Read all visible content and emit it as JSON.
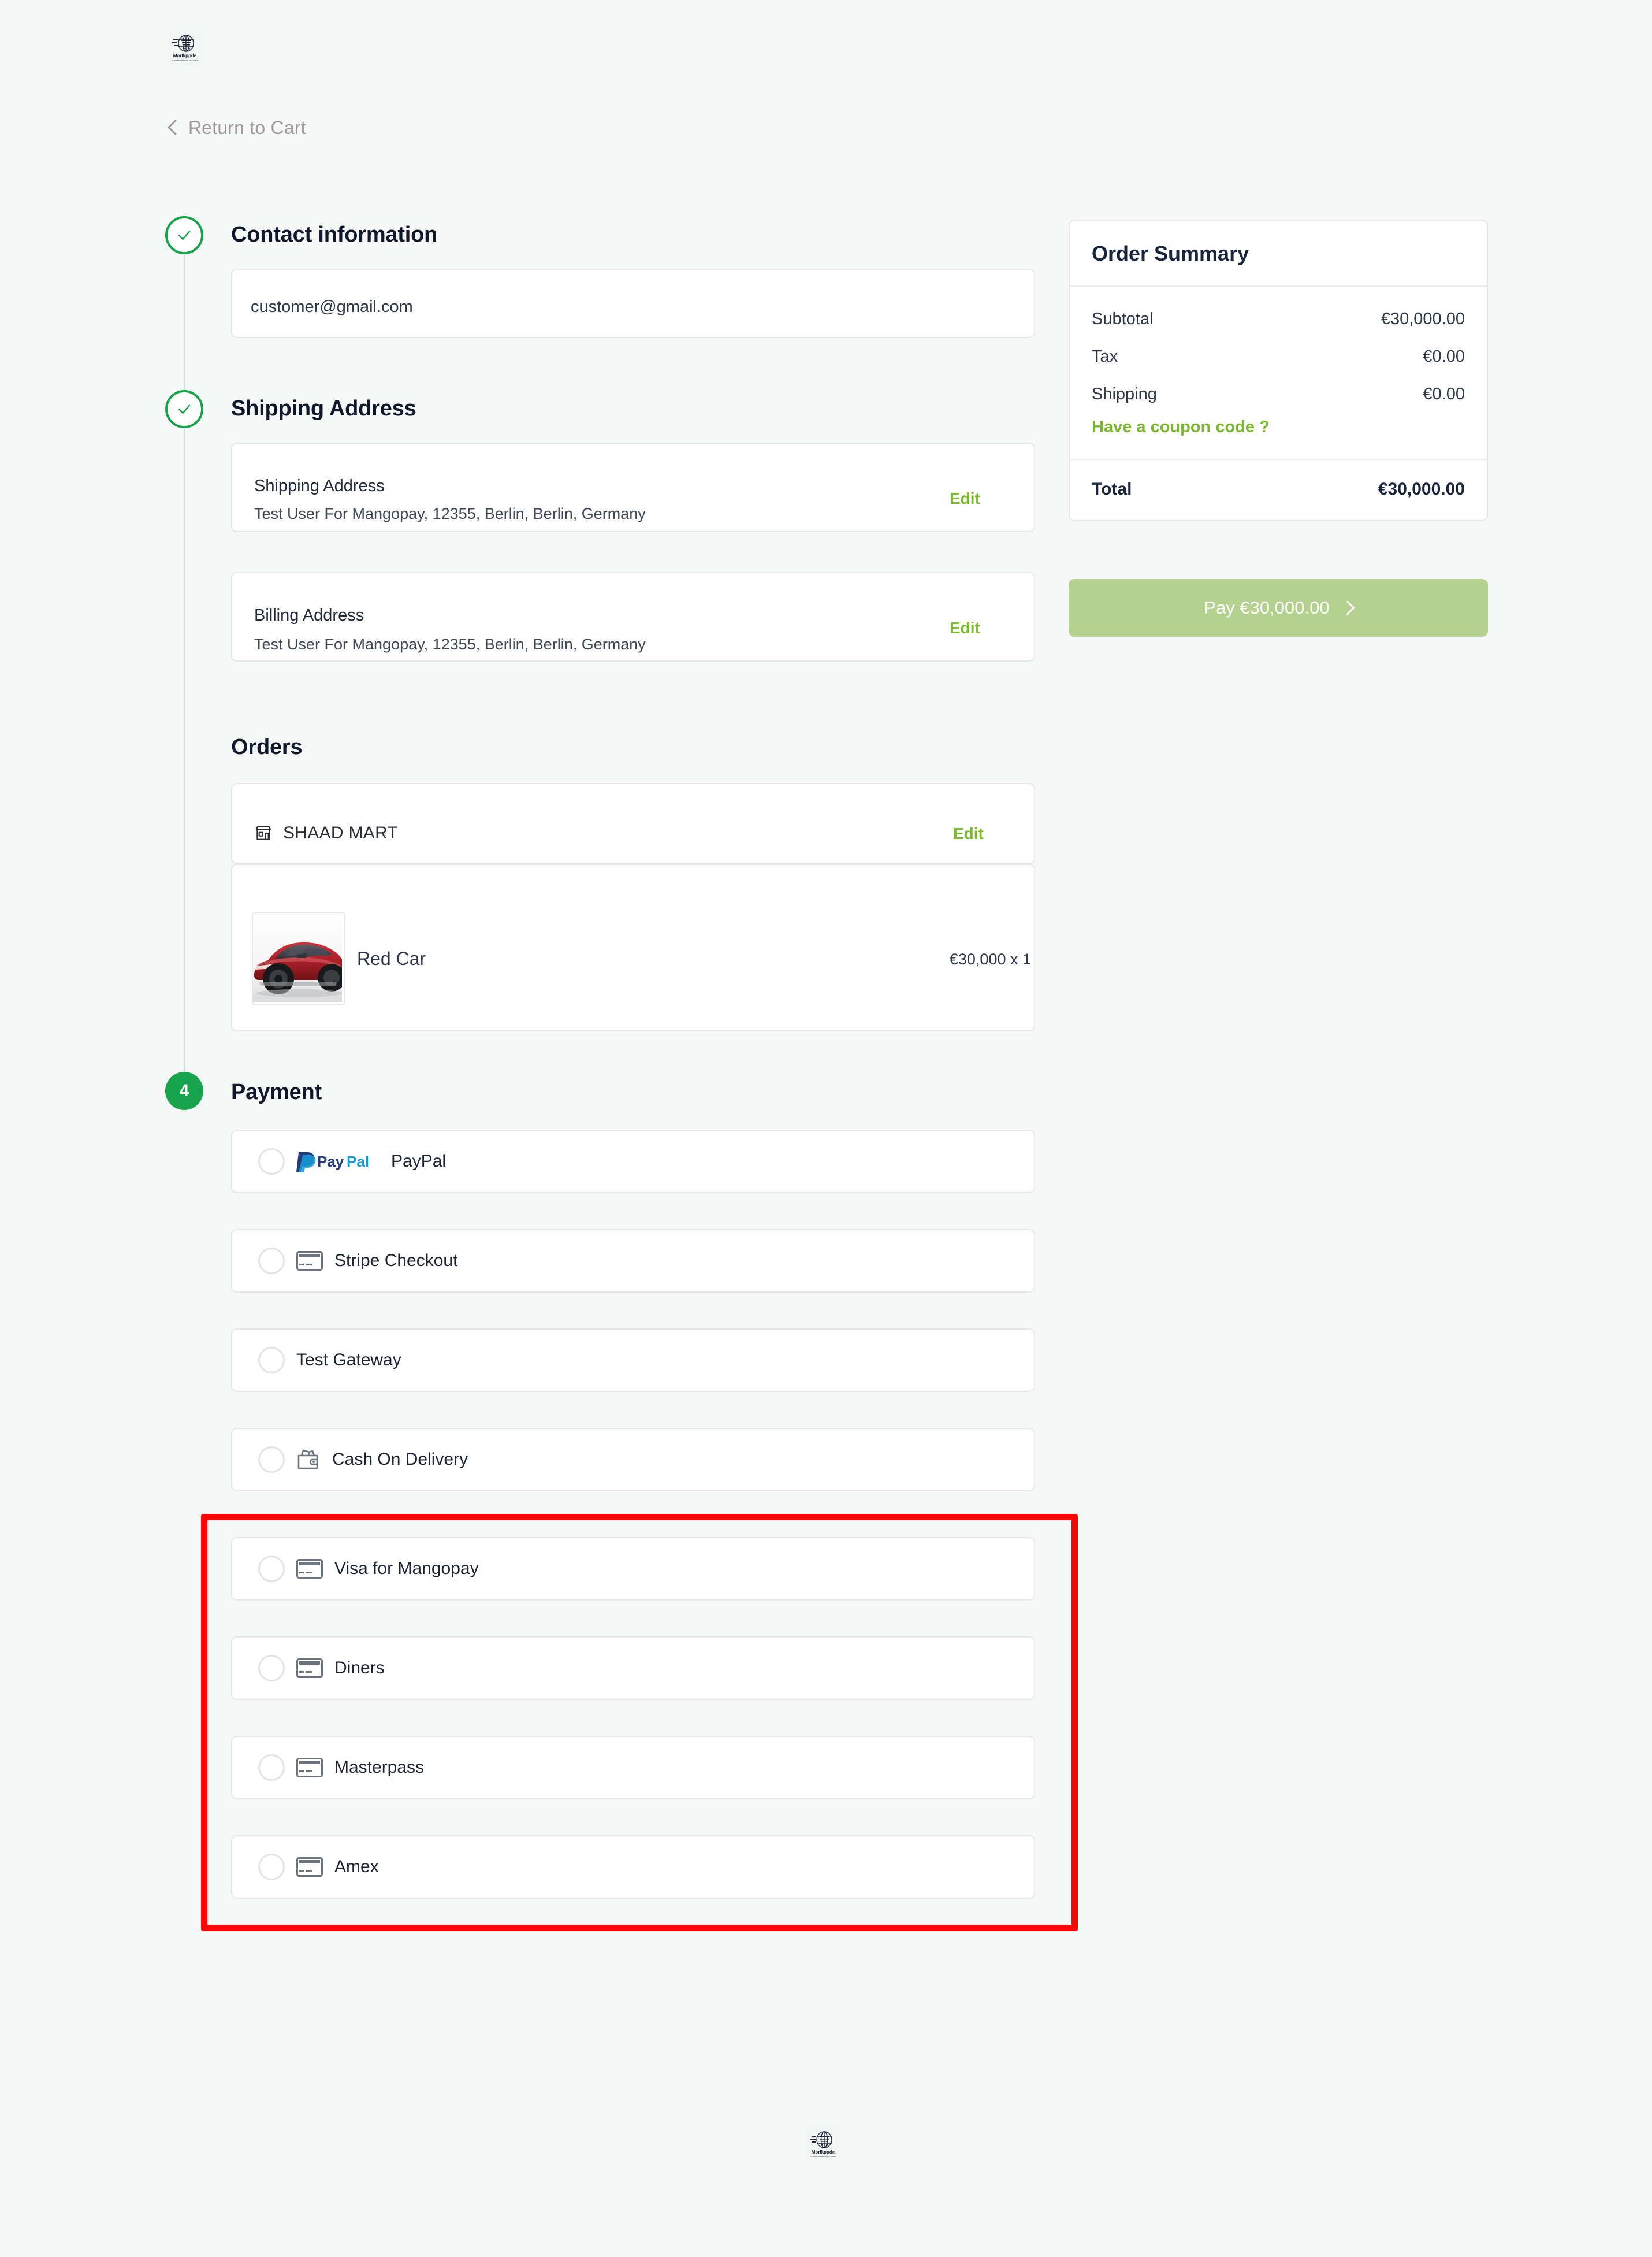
{
  "brand": {
    "name": "Morlkppde",
    "tagline": "The world's destination of your checkout",
    "logo_icon": "globe-cart-logo"
  },
  "nav": {
    "return_to_cart": "Return to Cart",
    "back_icon": "chevron-left-icon"
  },
  "steps": [
    {
      "id": "contact",
      "marker": "check-circle-icon",
      "state": "done",
      "title": "Contact information"
    },
    {
      "id": "shipping",
      "marker": "check-circle-icon",
      "state": "done",
      "title": "Shipping Address"
    },
    {
      "id": "orders",
      "marker": "",
      "state": "plain",
      "title": "Orders"
    },
    {
      "id": "payment",
      "marker": "4",
      "state": "active",
      "title": "Payment"
    }
  ],
  "contact": {
    "email": "customer@gmail.com"
  },
  "addresses": [
    {
      "title": "Shipping Address",
      "line": "Test User For Mangopay, 12355, Berlin, Berlin, Germany",
      "edit_label": "Edit"
    },
    {
      "title": "Billing Address",
      "line": "Test User For Mangopay, 12355, Berlin, Berlin, Germany",
      "edit_label": "Edit"
    }
  ],
  "orders": {
    "store_name": "SHAAD MART",
    "store_icon": "storefront-icon",
    "edit_label": "Edit",
    "items": [
      {
        "name": "Red Car",
        "price_qty": "€30,000 x 1",
        "thumbnail": "red-car-photo"
      }
    ]
  },
  "payment": {
    "methods": [
      {
        "id": "paypal",
        "label": "PayPal",
        "icon": "paypal-logo",
        "selected": false,
        "highlighted": false
      },
      {
        "id": "stripe",
        "label": "Stripe Checkout",
        "icon": "credit-card-icon",
        "selected": false,
        "highlighted": false
      },
      {
        "id": "test",
        "label": "Test Gateway",
        "icon": "",
        "selected": false,
        "highlighted": false
      },
      {
        "id": "cod",
        "label": "Cash On Delivery",
        "icon": "wallet-icon",
        "selected": false,
        "highlighted": false
      },
      {
        "id": "visa_mp",
        "label": "Visa for Mangopay",
        "icon": "credit-card-icon",
        "selected": false,
        "highlighted": true
      },
      {
        "id": "diners",
        "label": "Diners",
        "icon": "credit-card-icon",
        "selected": false,
        "highlighted": true
      },
      {
        "id": "masterpass",
        "label": "Masterpass",
        "icon": "credit-card-icon",
        "selected": false,
        "highlighted": true
      },
      {
        "id": "amex",
        "label": "Amex",
        "icon": "credit-card-icon",
        "selected": false,
        "highlighted": true
      }
    ]
  },
  "summary": {
    "title": "Order Summary",
    "rows": [
      {
        "label": "Subtotal",
        "value": "€30,000.00"
      },
      {
        "label": "Tax",
        "value": "€0.00"
      },
      {
        "label": "Shipping",
        "value": "€0.00"
      }
    ],
    "coupon_label": "Have a coupon code ?",
    "total_label": "Total",
    "total_value": "€30,000.00",
    "pay_button_label": "Pay €30,000.00",
    "pay_button_icon": "chevron-right-icon"
  },
  "colors": {
    "accent_green": "#7cb82f",
    "step_green": "#17a44c",
    "pay_button": "#b5d18f",
    "highlight_red": "#fc0505",
    "page_bg": "#f6f7f7"
  }
}
